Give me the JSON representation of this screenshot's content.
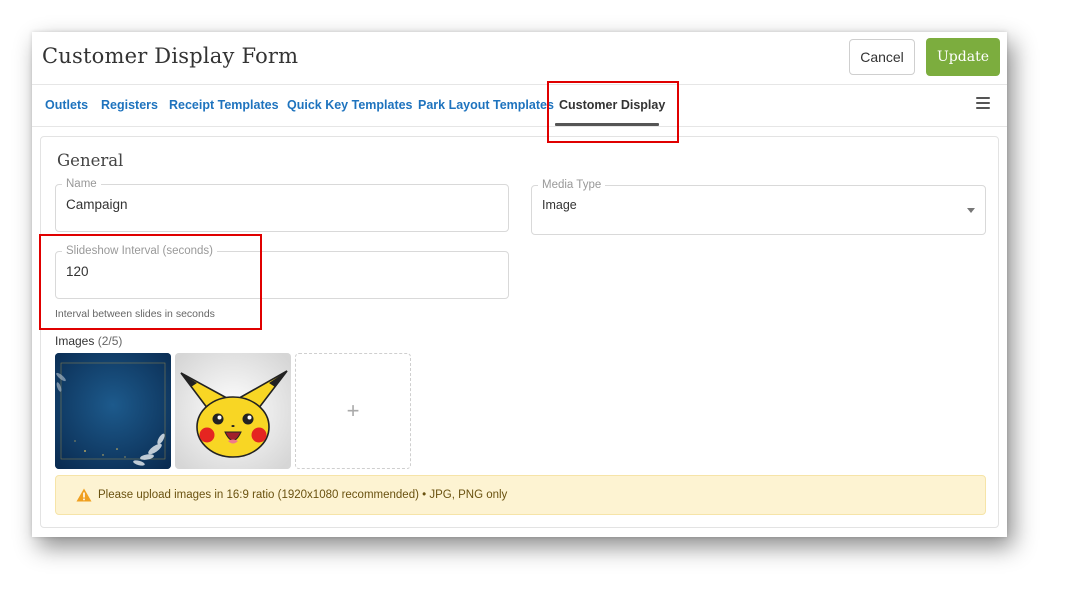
{
  "header": {
    "title": "Customer Display Form",
    "cancel_label": "Cancel",
    "update_label": "Update"
  },
  "tabs": [
    {
      "label": "Outlets"
    },
    {
      "label": "Registers"
    },
    {
      "label": "Receipt Templates"
    },
    {
      "label": "Quick Key Templates"
    },
    {
      "label": "Park Layout Templates"
    },
    {
      "label": "Customer Display",
      "active": true
    }
  ],
  "section": {
    "title": "General"
  },
  "form": {
    "name": {
      "label": "Name",
      "value": "Campaign"
    },
    "media_type": {
      "label": "Media Type",
      "value": "Image"
    },
    "slideshow": {
      "label": "Slideshow Interval (seconds)",
      "value": "120",
      "helper": "Interval between slides in seconds"
    }
  },
  "images": {
    "label": "Images",
    "count": "(2/5)",
    "add_symbol": "+"
  },
  "notice": {
    "text": "Please upload images in 16:9 ratio (1920x1080 recommended) • JPG, PNG only",
    "icon": "warning-icon"
  },
  "colors": {
    "accent": "#1e73be",
    "update_button": "#7cad3e",
    "highlight": "#e00000",
    "notice_bg": "#fdf3d2"
  }
}
